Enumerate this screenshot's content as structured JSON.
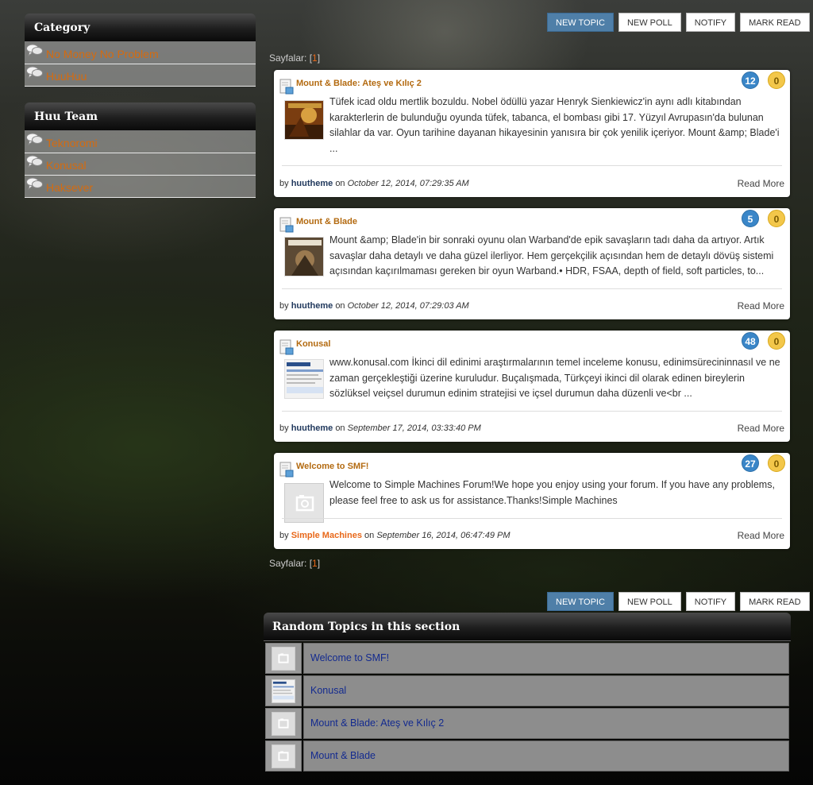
{
  "sidebar": {
    "category": {
      "title": "Category",
      "items": [
        {
          "label": "No Money No Problem"
        },
        {
          "label": "HuuHuu"
        }
      ]
    },
    "team": {
      "title": "Huu Team",
      "items": [
        {
          "label": "Teknoromi"
        },
        {
          "label": "Konusal"
        },
        {
          "label": "Haksever"
        }
      ]
    }
  },
  "toolbar": {
    "new_topic": "NEW TOPIC",
    "new_poll": "NEW POLL",
    "notify": "NOTIFY",
    "mark_read": "MARK READ"
  },
  "pagination": {
    "label": "Sayfalar:",
    "bracket_open": "[",
    "current": "1",
    "bracket_close": "]"
  },
  "topics": [
    {
      "title": "Mount & Blade: Ateş ve Kılıç 2",
      "replies": "12",
      "views": "0",
      "excerpt": "Tüfek icad oldu mertlik bozuldu. Nobel ödüllü yazar Henryk Sienkiewicz'in aynı adlı kitabından karakterlerin de bulunduğu oyunda tüfek, tabanca, el bombası gibi 17. Yüzyıl Avrupasın'da bulunan silahlar da var. Oyun tarihine dayanan hikayesinin yanısıra bir çok yenilik içeriyor. Mount &amp; Blade'i ...",
      "by": "by",
      "author": "huutheme",
      "on": "on",
      "date": "October 12, 2014, 07:29:35 AM",
      "read_more": "Read More"
    },
    {
      "title": "Mount & Blade",
      "replies": "5",
      "views": "0",
      "excerpt": "Mount &amp; Blade'in bir sonraki oyunu olan Warband'de epik savaşların tadı daha da artıyor. Artık savaşlar daha detaylı ve daha güzel ilerliyor. Hem gerçekçilik açısından hem de detaylı dövüş sistemi açısından kaçırılmaması gereken bir oyun Warband.• HDR, FSAA, depth of field, soft particles, to...",
      "by": "by",
      "author": "huutheme",
      "on": "on",
      "date": "October 12, 2014, 07:29:03 AM",
      "read_more": "Read More"
    },
    {
      "title": "Konusal",
      "replies": "48",
      "views": "0",
      "excerpt": "www.konusal.com İkinci dil edinimi araştırmalarının temel inceleme konusu, edinimsürecininnasıl ve ne zaman gerçekleştiği üzerine kuruludur.  Buçalışmada, Türkçeyi ikinci dil olarak edinen bireylerin sözlüksel veiçsel durumun edinim stratejisi ve içsel durumun daha düzenli ve<br ...",
      "by": "by",
      "author": "huutheme",
      "on": "on",
      "date": "September 17, 2014, 03:33:40 PM",
      "read_more": "Read More"
    },
    {
      "title": "Welcome to SMF!",
      "replies": "27",
      "views": "0",
      "excerpt": "Welcome to Simple Machines Forum!We hope you enjoy using your forum.  If you have any problems, please feel free to ask us for assistance.Thanks!Simple Machines",
      "by": "by",
      "author": "Simple Machines",
      "on": "on",
      "date": "September 16, 2014, 06:47:49 PM",
      "read_more": "Read More"
    }
  ],
  "random_topics": {
    "title": "Random Topics in this section",
    "items": [
      {
        "label": "Welcome to SMF!"
      },
      {
        "label": "Konusal"
      },
      {
        "label": "Mount & Blade: Ateş ve Kılıç 2"
      },
      {
        "label": "Mount & Blade"
      }
    ]
  },
  "colors": {
    "accent_orange": "#e8681a",
    "primary_button": "#4f7fa8",
    "reply_badge": "#3a86c8",
    "view_badge": "#f3c74a",
    "link_blue": "#132a8f"
  }
}
